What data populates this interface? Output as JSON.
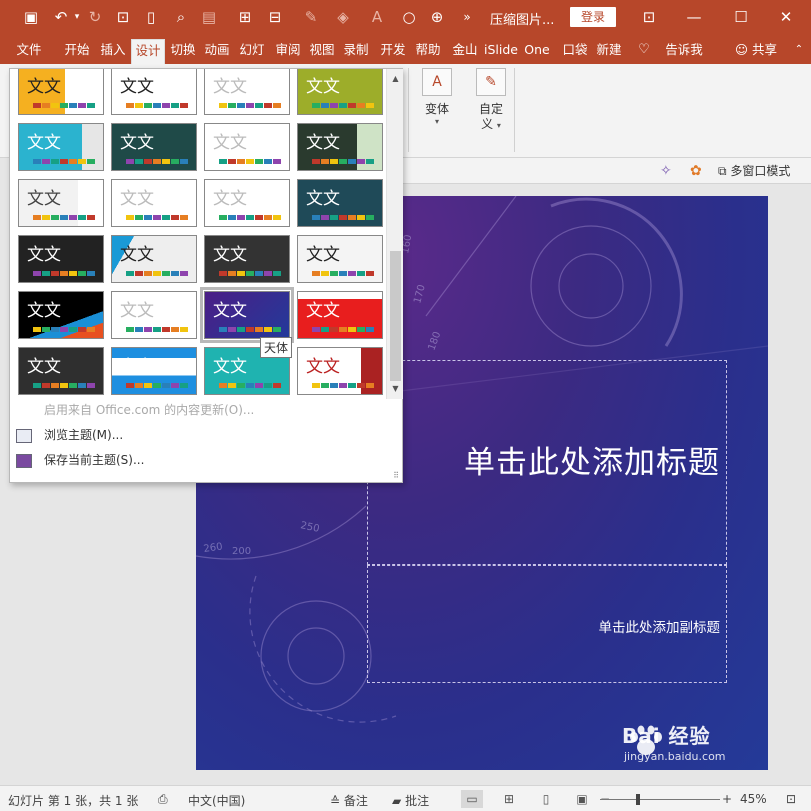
{
  "titlebar": {
    "doc_title": "压缩图片...",
    "login_label": "登录",
    "quick_access": [
      "save-icon",
      "undo-icon",
      "redo-icon",
      "slideshow-icon",
      "new-icon",
      "preview-icon",
      "picture-icon",
      "grid-icon",
      "layout-icon",
      "pen-icon",
      "fill-icon",
      "font-color-icon",
      "shape-icon",
      "select-icon"
    ]
  },
  "tabs": [
    "文件",
    "开始",
    "插入",
    "设计",
    "切换",
    "动画",
    "幻灯",
    "审阅",
    "视图",
    "录制",
    "开发",
    "帮助",
    "金山",
    "iSlide",
    "One",
    "口袋",
    "新建",
    "告诉我",
    "共享"
  ],
  "active_tab": "设计",
  "ribbon": {
    "variants_label": "变体",
    "customize_label_1": "自定",
    "customize_label_2": "义"
  },
  "strip": {
    "multiwindow_label": "多窗口模式"
  },
  "gallery": {
    "thumb_text": "文文",
    "tooltip": "天体",
    "menu": [
      {
        "label": "启用来自 Office.com 的内容更新(O)...",
        "enabled": false
      },
      {
        "label": "浏览主题(M)...",
        "enabled": true
      },
      {
        "label": "保存当前主题(S)...",
        "enabled": true
      }
    ]
  },
  "slide": {
    "title_placeholder": "单击此处添加标题",
    "subtitle_placeholder": "单击此处添加副标题",
    "ring_labels": [
      "160",
      "170",
      "180",
      "250",
      "260",
      "200"
    ]
  },
  "statusbar": {
    "slide_info": "幻灯片 第 1 张，共 1 张",
    "language": "中文(中国)",
    "notes_label": "备注",
    "comments_label": "批注",
    "zoom": "45%"
  },
  "watermark": {
    "main": "Bai 经验",
    "sub": "jingyan.baidu.com"
  },
  "colors": {
    "accent": "#b7472a",
    "slide_bg": "#3c2a82"
  }
}
